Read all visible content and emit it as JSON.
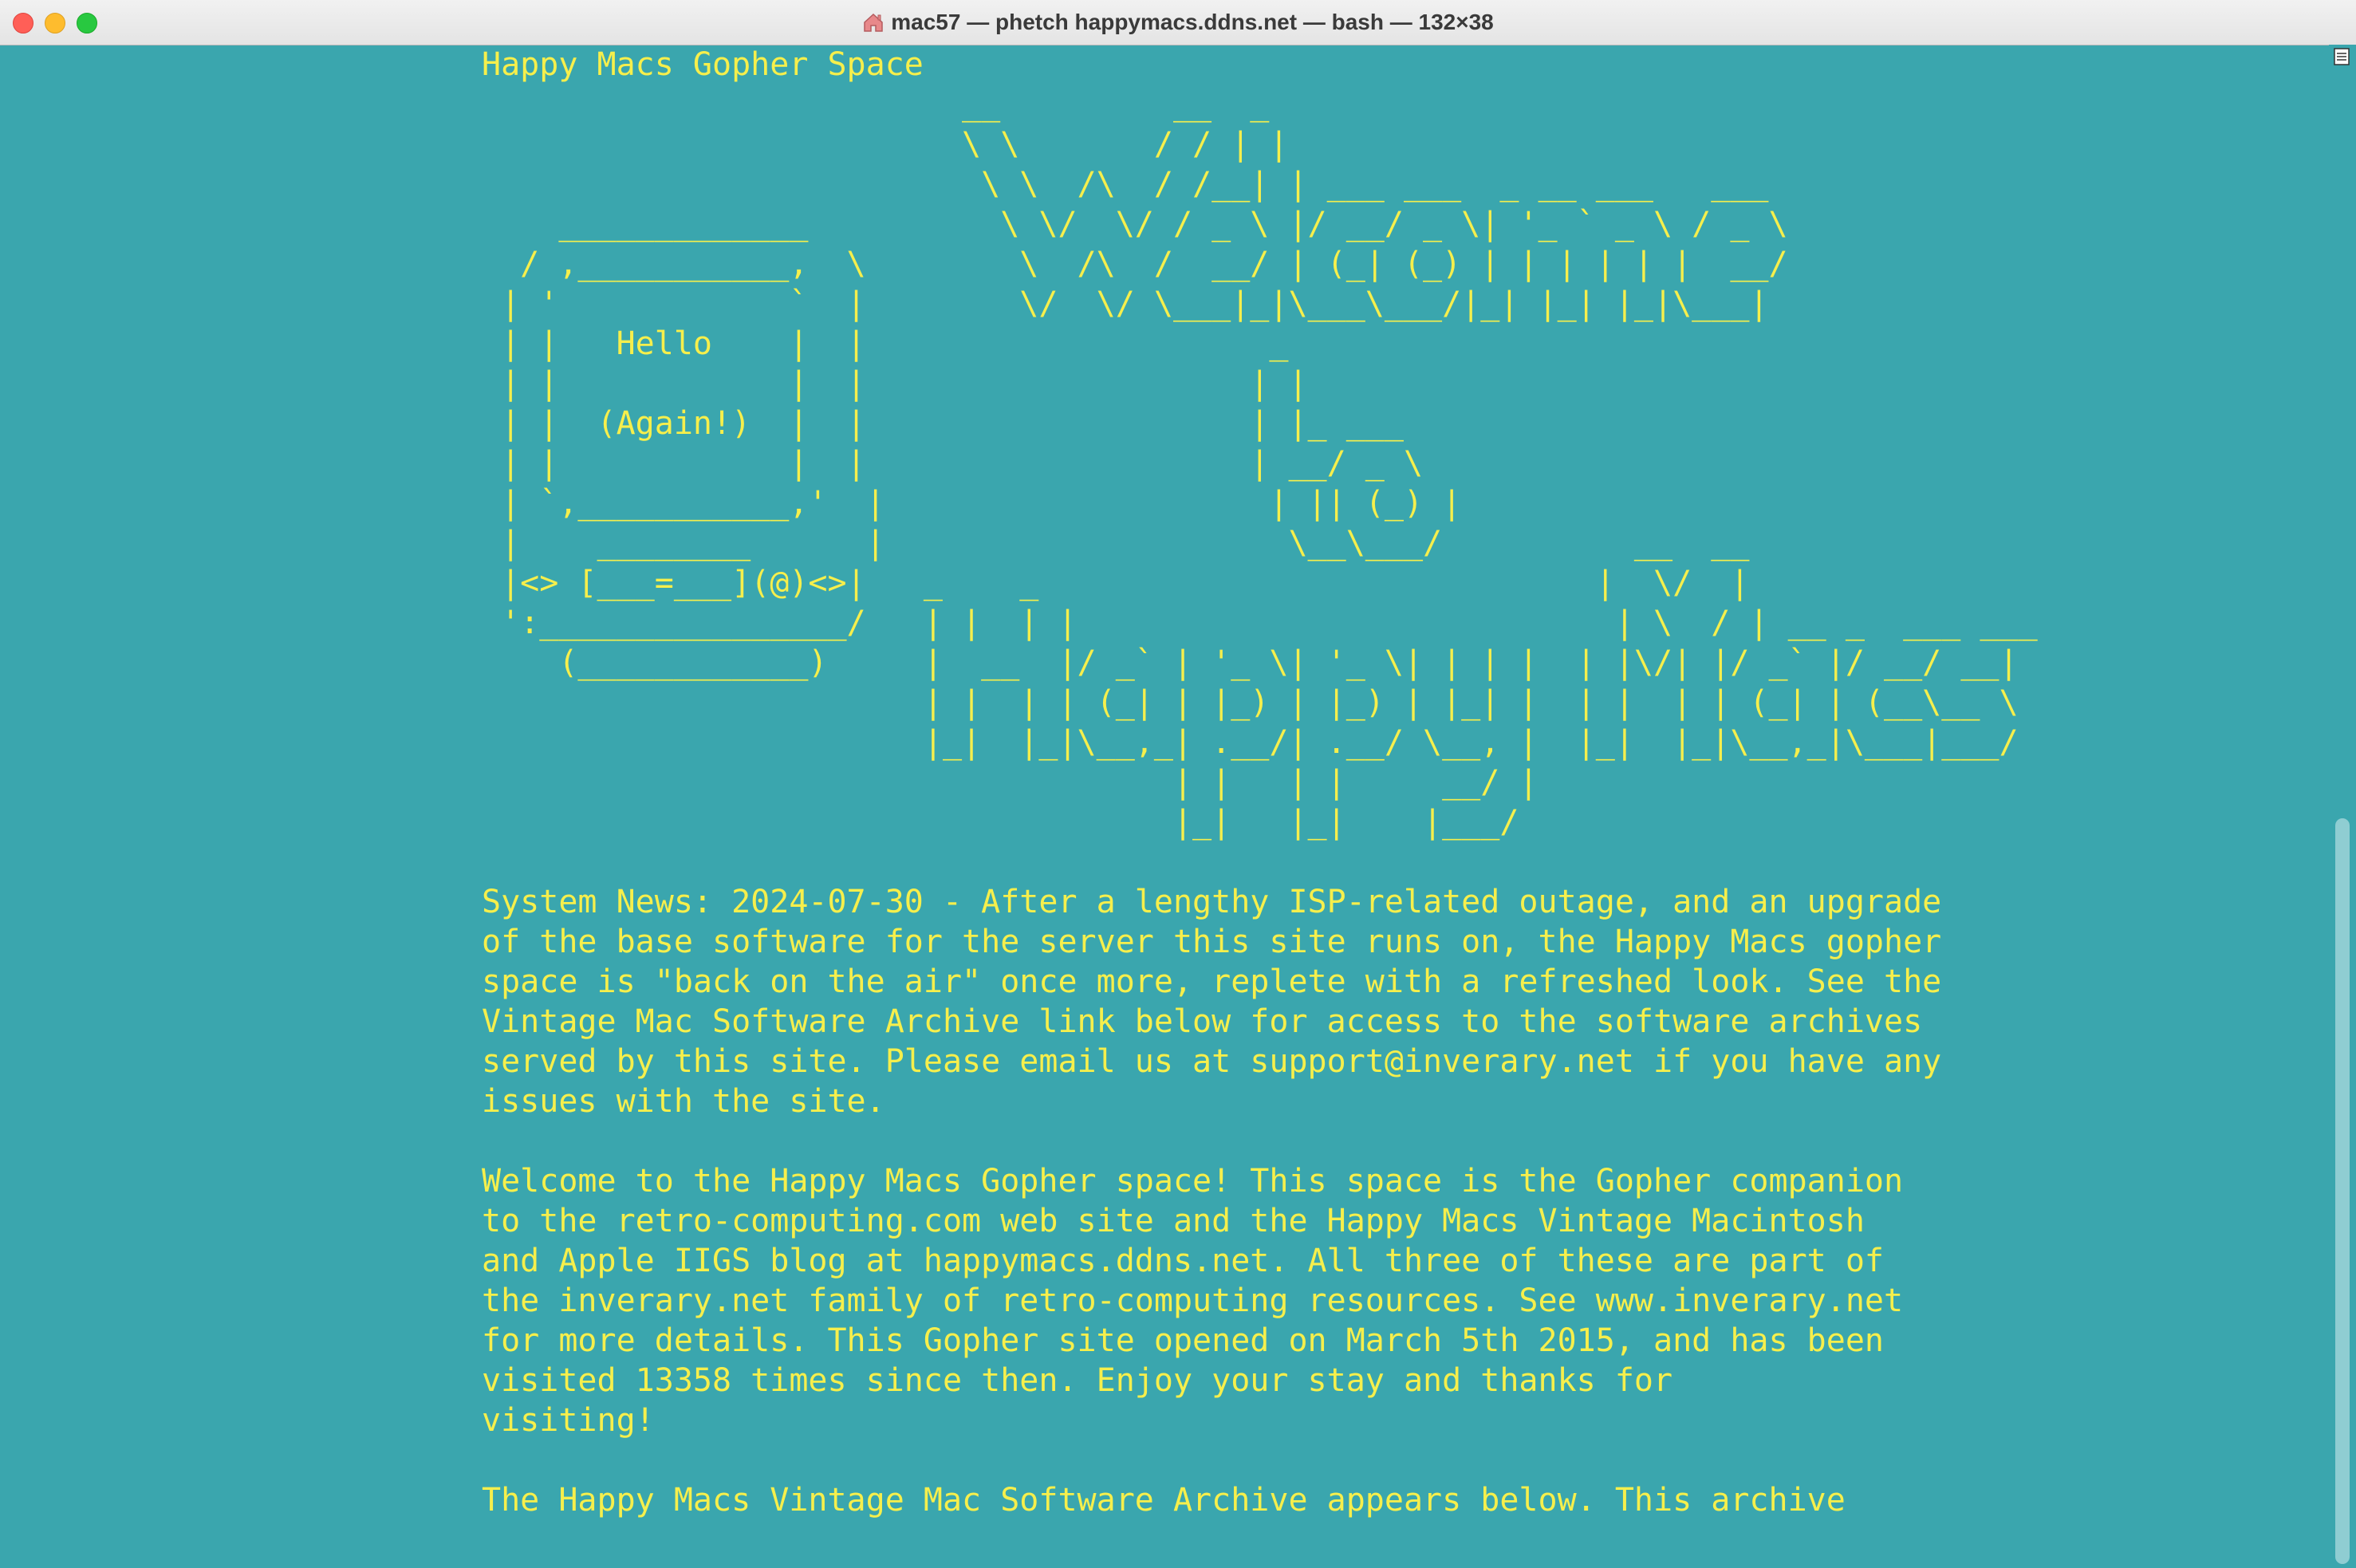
{
  "window": {
    "title": "mac57 — phetch happymacs.ddns.net — bash — 132×38"
  },
  "terminal": {
    "lines": [
      "Happy Macs Gopher Space",
      "                         __         __  _",
      "                         \\ \\       / / | |",
      "                          \\ \\  /\\  / /__| | ___ ___  _ __ ___   ___",
      "    _____________          \\ \\/  \\/ / _ \\ |/ __/ _ \\| '_ ` _ \\ / _ \\",
      "  / ,___________,  \\        \\  /\\  /  __/ | (_| (_) | | | | | |  __/",
      " | '            `  |        \\/  \\/ \\___|_|\\___\\___/|_| |_| |_|\\___|",
      " | |   Hello    |  |                     _",
      " | |            |  |                    | |",
      " | |  (Again!)  |  |                    | |_ ___",
      " | |            |  |                    | __/ _ \\",
      " | `,___________,'  |                    | || (_) |",
      " |    ________      |                     \\__\\___/          __  __",
      " |<> [___=___](@)<>|   _    _                             |  \\/  |",
      " ':________________/   | |  | |                            | \\  / | __ _  ___ ___",
      "    (____________)     |  __  |/ _` | '_ \\| '_ \\| | | |  | |\\/| |/ _` |/ __/ __|",
      "                       | |  | | (_| | |_) | |_) | |_| |  | |  | | (_| | (__\\__ \\",
      "                       |_|  |_|\\__,_| .__/| .__/ \\__, |  |_|  |_|\\__,_|\\___|___/",
      "                                    | |   | |     __/ |",
      "                                    |_|   |_|    |___/",
      "",
      "System News: 2024-07-30 - After a lengthy ISP-related outage, and an upgrade",
      "of the base software for the server this site runs on, the Happy Macs gopher",
      "space is \"back on the air\" once more, replete with a refreshed look. See the",
      "Vintage Mac Software Archive link below for access to the software archives",
      "served by this site. Please email us at support@inverary.net if you have any",
      "issues with the site.",
      "",
      "Welcome to the Happy Macs Gopher space! This space is the Gopher companion",
      "to the retro-computing.com web site and the Happy Macs Vintage Macintosh",
      "and Apple IIGS blog at happymacs.ddns.net. All three of these are part of",
      "the inverary.net family of retro-computing resources. See www.inverary.net",
      "for more details. This Gopher site opened on March 5th 2015, and has been",
      "visited 13358 times since then. Enjoy your stay and thanks for",
      "visiting!",
      "",
      "The Happy Macs Vintage Mac Software Archive appears below. This archive"
    ]
  },
  "colors": {
    "background": "#3aa6ae",
    "text": "#f6ef4c"
  },
  "icons": {
    "title": "home-folder-icon",
    "scroll_marker": "mark-lines-icon"
  }
}
